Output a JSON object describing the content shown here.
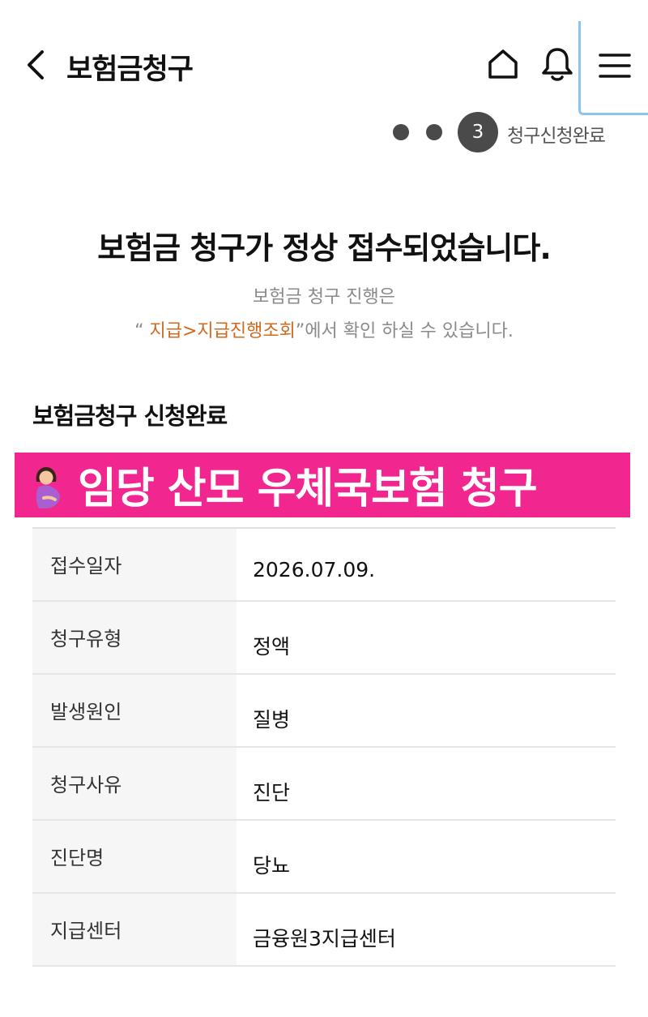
{
  "header": {
    "title": "보험금청구"
  },
  "steps": {
    "current_step": "3",
    "current_label": "청구신청완료"
  },
  "main": {
    "title": "보험금 청구가 정상 접수되었습니다.",
    "sub_line1": "보험금 청구 진행은",
    "sub_quote_open": "“ ",
    "sub_link": "지급>지급진행조회",
    "sub_rest": "”에서 확인 하실 수 있습니다."
  },
  "section": {
    "title": "보험금청구 신청완료"
  },
  "banner": {
    "text": "임당 산모 우체국보험 청구"
  },
  "table": {
    "rows": [
      {
        "label": "접수일자",
        "value": "2026.07.09."
      },
      {
        "label": "청구유형",
        "value": "정액"
      },
      {
        "label": "발생원인",
        "value": "질병"
      },
      {
        "label": "청구사유",
        "value": "진단"
      },
      {
        "label": "진단명",
        "value": "당뇨"
      },
      {
        "label": "지급센터",
        "value": "금융원3지급센터"
      }
    ]
  },
  "colors": {
    "banner_bg": "#f2268f",
    "link": "#d2691e",
    "step_dot": "#4a4a4a",
    "menu_highlight": "#8cc4f0"
  },
  "icons": [
    "chevron-left-icon",
    "home-icon",
    "bell-icon",
    "menu-icon",
    "pregnant-woman-icon"
  ]
}
